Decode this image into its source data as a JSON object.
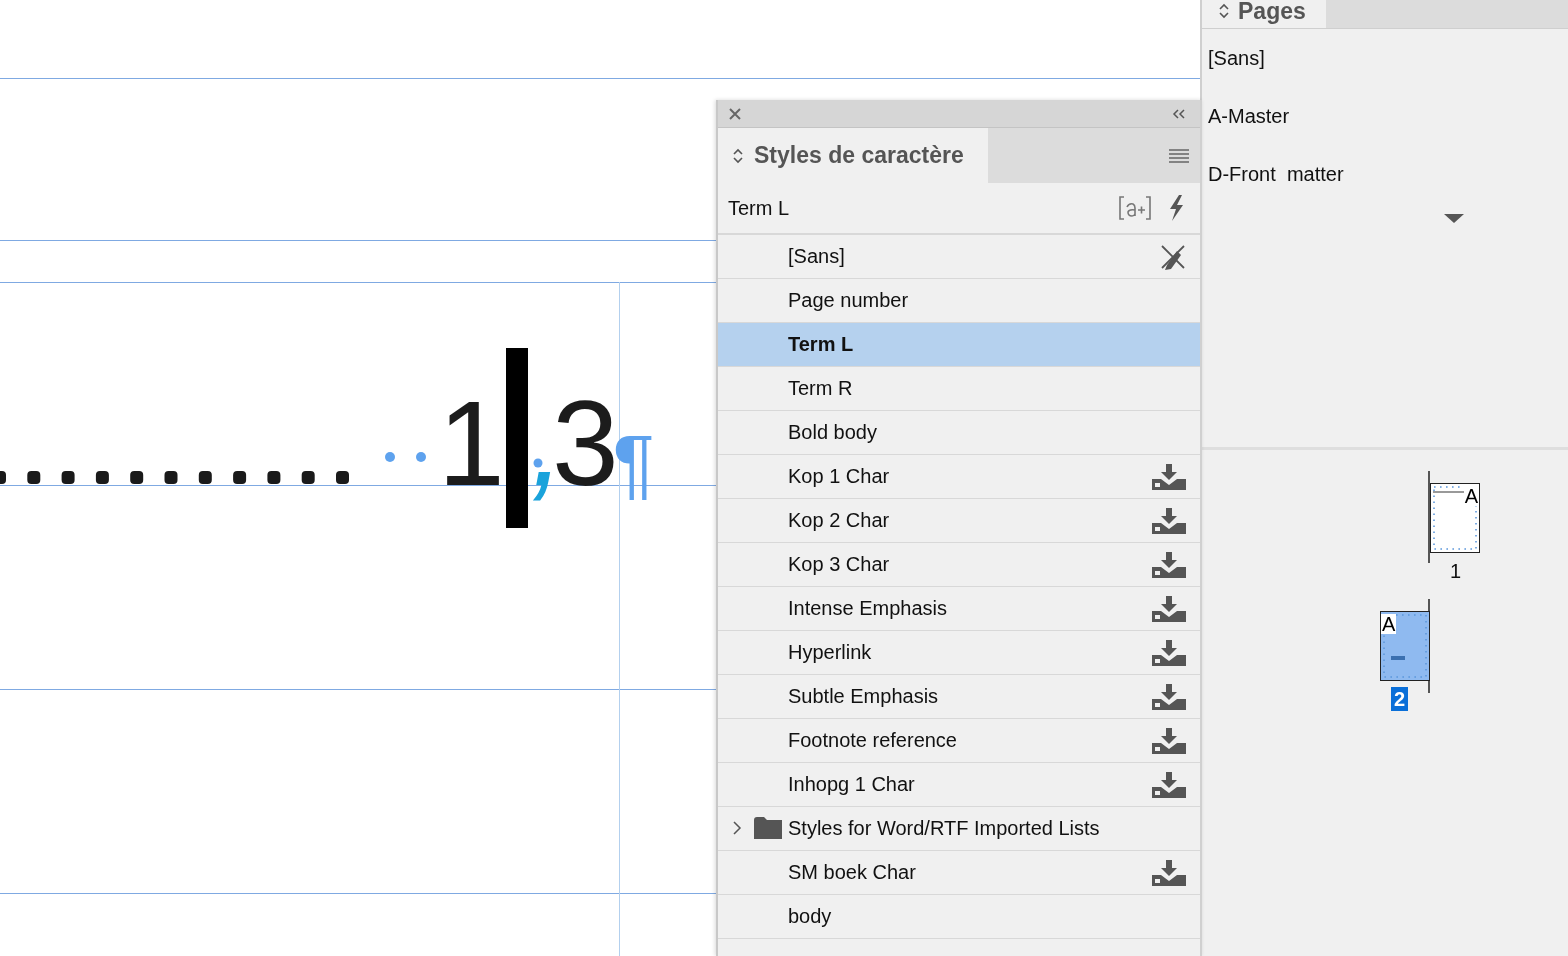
{
  "canvas": {
    "number": {
      "before": "1",
      "separator": ",",
      "after": "3"
    },
    "end_mark": "¶"
  },
  "styles_panel": {
    "title": "Styles de caractère",
    "current_style": "Term L",
    "items": [
      {
        "label": "[Sans]",
        "kind": "locked",
        "selected": false
      },
      {
        "label": "Page number",
        "kind": "plain",
        "selected": false
      },
      {
        "label": "Term L",
        "kind": "plain",
        "selected": true
      },
      {
        "label": "Term R",
        "kind": "plain",
        "selected": false
      },
      {
        "label": "Bold body",
        "kind": "plain",
        "selected": false
      },
      {
        "label": "Kop 1 Char",
        "kind": "imported",
        "selected": false
      },
      {
        "label": "Kop 2 Char",
        "kind": "imported",
        "selected": false
      },
      {
        "label": "Kop 3 Char",
        "kind": "imported",
        "selected": false
      },
      {
        "label": "Intense Emphasis",
        "kind": "imported",
        "selected": false
      },
      {
        "label": "Hyperlink",
        "kind": "imported",
        "selected": false
      },
      {
        "label": "Subtle Emphasis",
        "kind": "imported",
        "selected": false
      },
      {
        "label": "Footnote reference",
        "kind": "imported",
        "selected": false
      },
      {
        "label": "Inhopg 1 Char",
        "kind": "imported",
        "selected": false
      },
      {
        "label": "Styles for Word/RTF Imported Lists",
        "kind": "folder",
        "expanded": false,
        "selected": false
      },
      {
        "label": "SM boek Char",
        "kind": "imported",
        "selected": false
      },
      {
        "label": "body",
        "kind": "plain",
        "selected": false
      }
    ]
  },
  "pages_panel": {
    "title": "Pages",
    "masters": [
      "[Sans]",
      "A-Master",
      "D-Front  matter"
    ],
    "pages": [
      {
        "number": "1",
        "master": "A",
        "selected": false
      },
      {
        "number": "2",
        "master": "A",
        "selected": true
      }
    ]
  }
}
